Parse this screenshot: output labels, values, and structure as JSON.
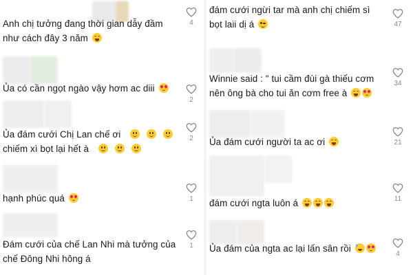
{
  "left": [
    {
      "text_lines": [
        "Anh chị tưởng đang thời gian dẫy đầm",
        "như cách đây 3 năm"
      ],
      "emojis_after": [
        "laugh"
      ],
      "likes": "4"
    },
    {
      "text_lines": [
        "Ủa có cần ngọt ngào vậy hơm ac diii"
      ],
      "emojis_after": [
        "love"
      ],
      "likes": "2"
    },
    {
      "text_lines": [
        "Ủa đám cưới Chị Lan chế ơi",
        "chiếm xì bọt lại hết à"
      ],
      "emojis_line1": [
        "smile",
        "smile",
        "smile"
      ],
      "emojis_after": [
        "smile",
        "smile",
        "smile"
      ],
      "likes": "2"
    },
    {
      "text_lines": [
        "hạnh phúc quá"
      ],
      "emojis_after": [
        "love"
      ],
      "likes": "1"
    },
    {
      "text_lines": [
        "Đám cưới của chế Lan Nhi mà tưởng của",
        "chế Đông Nhi hông á"
      ],
      "emojis_after": [],
      "likes": "1"
    }
  ],
  "right": [
    {
      "text_lines": [
        "đám cưới ngừi tar mà anh chị chiếm sì",
        "bọt laii dị á"
      ],
      "emojis_after": [
        "wink"
      ],
      "likes": "47"
    },
    {
      "text_lines": [
        "Winnie said : \" tui cầm đùi gà thiếu cơm",
        "nên ông bà cho tui ăn cơm free à"
      ],
      "emojis_after": [
        "laugh",
        "love"
      ],
      "likes": "34"
    },
    {
      "text_lines": [
        "Ủa đám cưới người ta ac ơi"
      ],
      "emojis_after": [
        "laugh"
      ],
      "likes": "21"
    },
    {
      "text_lines": [
        "đám cưới ngta luôn á"
      ],
      "emojis_after": [
        "laugh",
        "laugh",
        "laugh"
      ],
      "likes": "11"
    },
    {
      "text_lines": [
        "Ủa đám của ngta ac lại lấn sân rồi"
      ],
      "emojis_after": [
        "sweat",
        "love"
      ],
      "likes": "4"
    }
  ]
}
